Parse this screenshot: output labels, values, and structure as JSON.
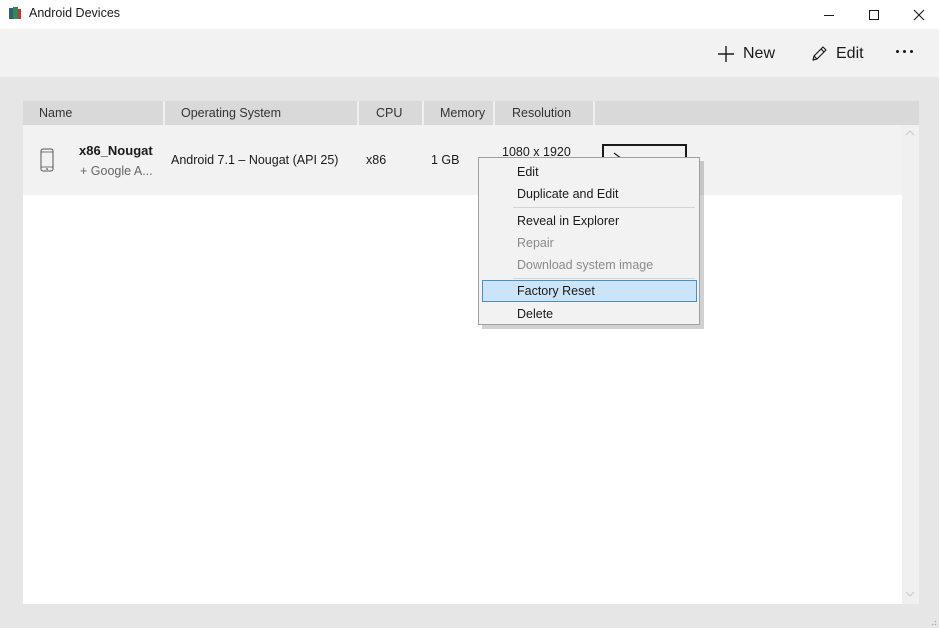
{
  "window": {
    "title": "Android Devices",
    "controls": {
      "minimize": "minimize-icon",
      "maximize": "maximize-icon",
      "close": "close-icon"
    }
  },
  "toolbar": {
    "new_label": "New",
    "edit_label": "Edit",
    "more_icon": "more-icon"
  },
  "table": {
    "columns": [
      "Name",
      "Operating System",
      "CPU",
      "Memory",
      "Resolution"
    ],
    "rows": [
      {
        "icon": "phone-icon",
        "name": "x86_Nougat",
        "subtitle": "+ Google A...",
        "os": "Android 7.1 – Nougat (API 25)",
        "cpu": "x86",
        "memory": "1 GB",
        "resolution": "1080 x 1920"
      }
    ]
  },
  "context_menu": {
    "items": [
      {
        "label": "Edit",
        "enabled": true
      },
      {
        "label": "Duplicate and Edit",
        "enabled": true
      },
      {
        "label": "Reveal in Explorer",
        "enabled": true
      },
      {
        "label": "Repair",
        "enabled": false
      },
      {
        "label": "Download system image",
        "enabled": false
      },
      {
        "label": "Factory Reset",
        "enabled": true,
        "highlighted": true
      },
      {
        "label": "Delete",
        "enabled": true
      }
    ]
  },
  "colors": {
    "highlight_fill": "#cce4f7",
    "highlight_border": "#4a90c8",
    "header_bg": "#d9d9d9"
  }
}
